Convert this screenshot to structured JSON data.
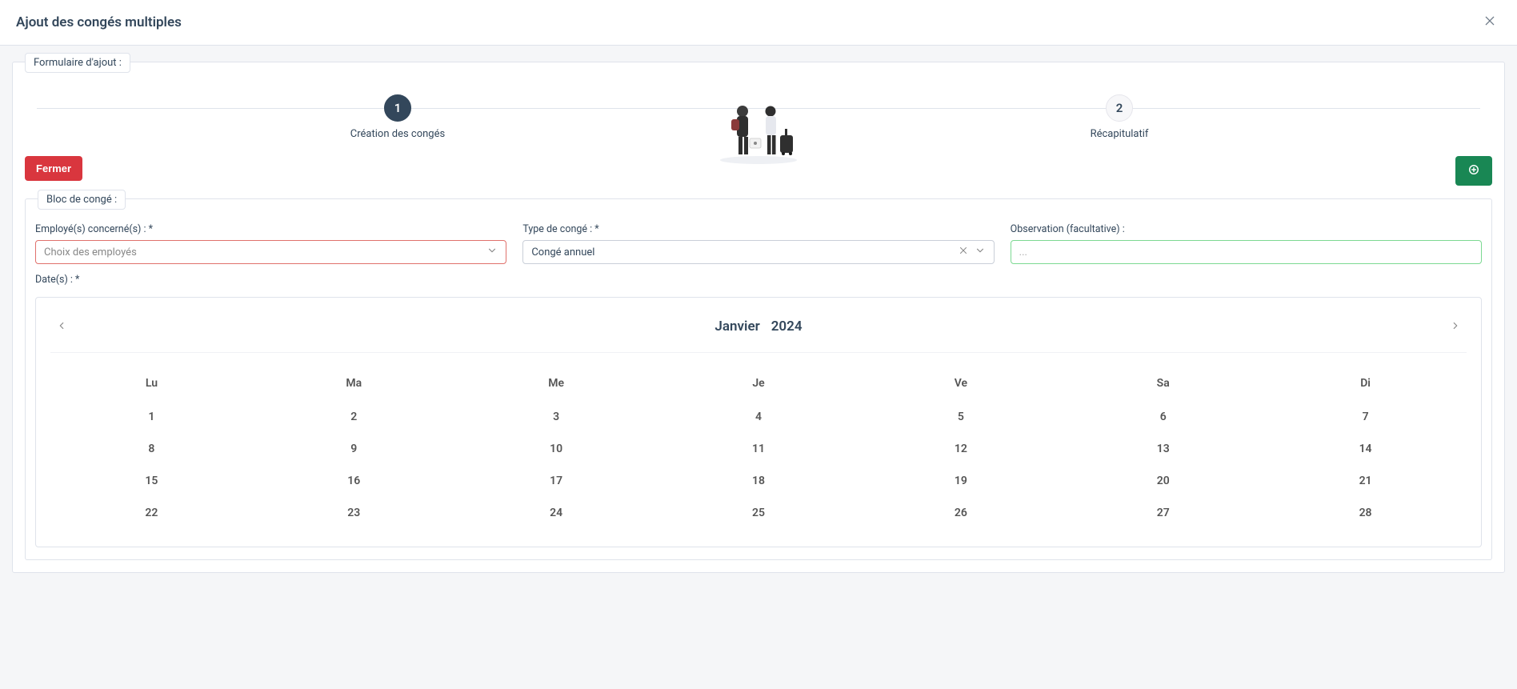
{
  "modal": {
    "title": "Ajout des congés multiples"
  },
  "form": {
    "legend": "Formulaire d'ajout :"
  },
  "stepper": {
    "steps": [
      {
        "num": "1",
        "label": "Création des congés",
        "active": true
      },
      {
        "num": "2",
        "label": "Récapitulatif",
        "active": false
      }
    ]
  },
  "actions": {
    "close_label": "Fermer"
  },
  "block": {
    "legend": "Bloc de congé :",
    "fields": {
      "employees": {
        "label": "Employé(s) concerné(s) : *",
        "placeholder": "Choix des employés"
      },
      "leave_type": {
        "label": "Type de congé : *",
        "value": "Congé annuel"
      },
      "observation": {
        "label": "Observation (facultative) :",
        "placeholder": "..."
      },
      "dates": {
        "label": "Date(s) : *"
      }
    }
  },
  "calendar": {
    "month": "Janvier",
    "year": "2024",
    "weekdays": [
      "Lu",
      "Ma",
      "Me",
      "Je",
      "Ve",
      "Sa",
      "Di"
    ],
    "weeks": [
      [
        "1",
        "2",
        "3",
        "4",
        "5",
        "6",
        "7"
      ],
      [
        "8",
        "9",
        "10",
        "11",
        "12",
        "13",
        "14"
      ],
      [
        "15",
        "16",
        "17",
        "18",
        "19",
        "20",
        "21"
      ],
      [
        "22",
        "23",
        "24",
        "25",
        "26",
        "27",
        "28"
      ]
    ]
  }
}
